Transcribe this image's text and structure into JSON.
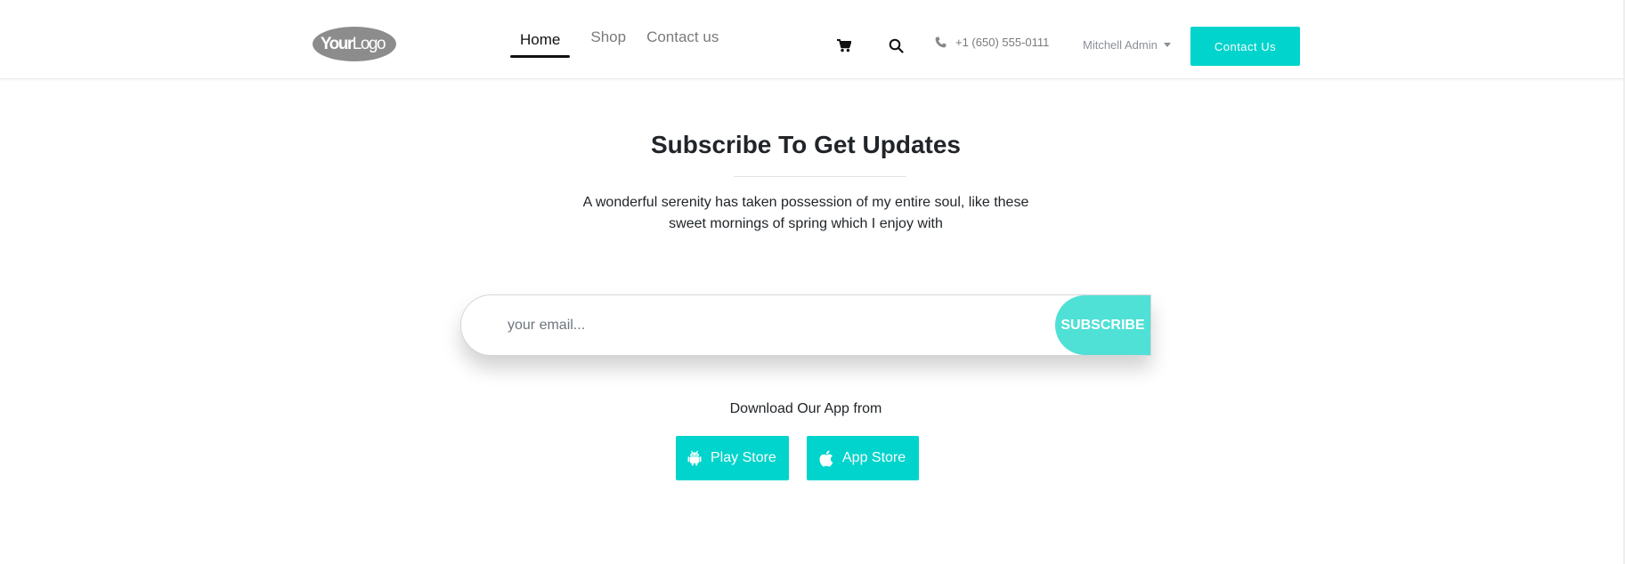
{
  "header": {
    "logo_text": "YourLogo",
    "nav": {
      "home": "Home",
      "shop": "Shop",
      "contact": "Contact us"
    },
    "phone": "+1 (650) 555-0111",
    "user": "Mitchell Admin",
    "contact_button": "Contact Us"
  },
  "main": {
    "title": "Subscribe To Get Updates",
    "description": "A wonderful serenity has taken possession of my entire soul, like these sweet mornings of spring which I enjoy with",
    "email_placeholder": "your email...",
    "subscribe_button": "SUBSCRIBE",
    "download_label": "Download Our App from",
    "play_store": "Play Store",
    "app_store": "App Store"
  },
  "colors": {
    "accent": "#00d4cc",
    "subscribe_button": "#4fe0d6",
    "text": "#212529",
    "muted": "#7a7a7a"
  },
  "icons": [
    "cart-icon",
    "search-icon",
    "phone-icon",
    "android-icon",
    "apple-icon"
  ]
}
